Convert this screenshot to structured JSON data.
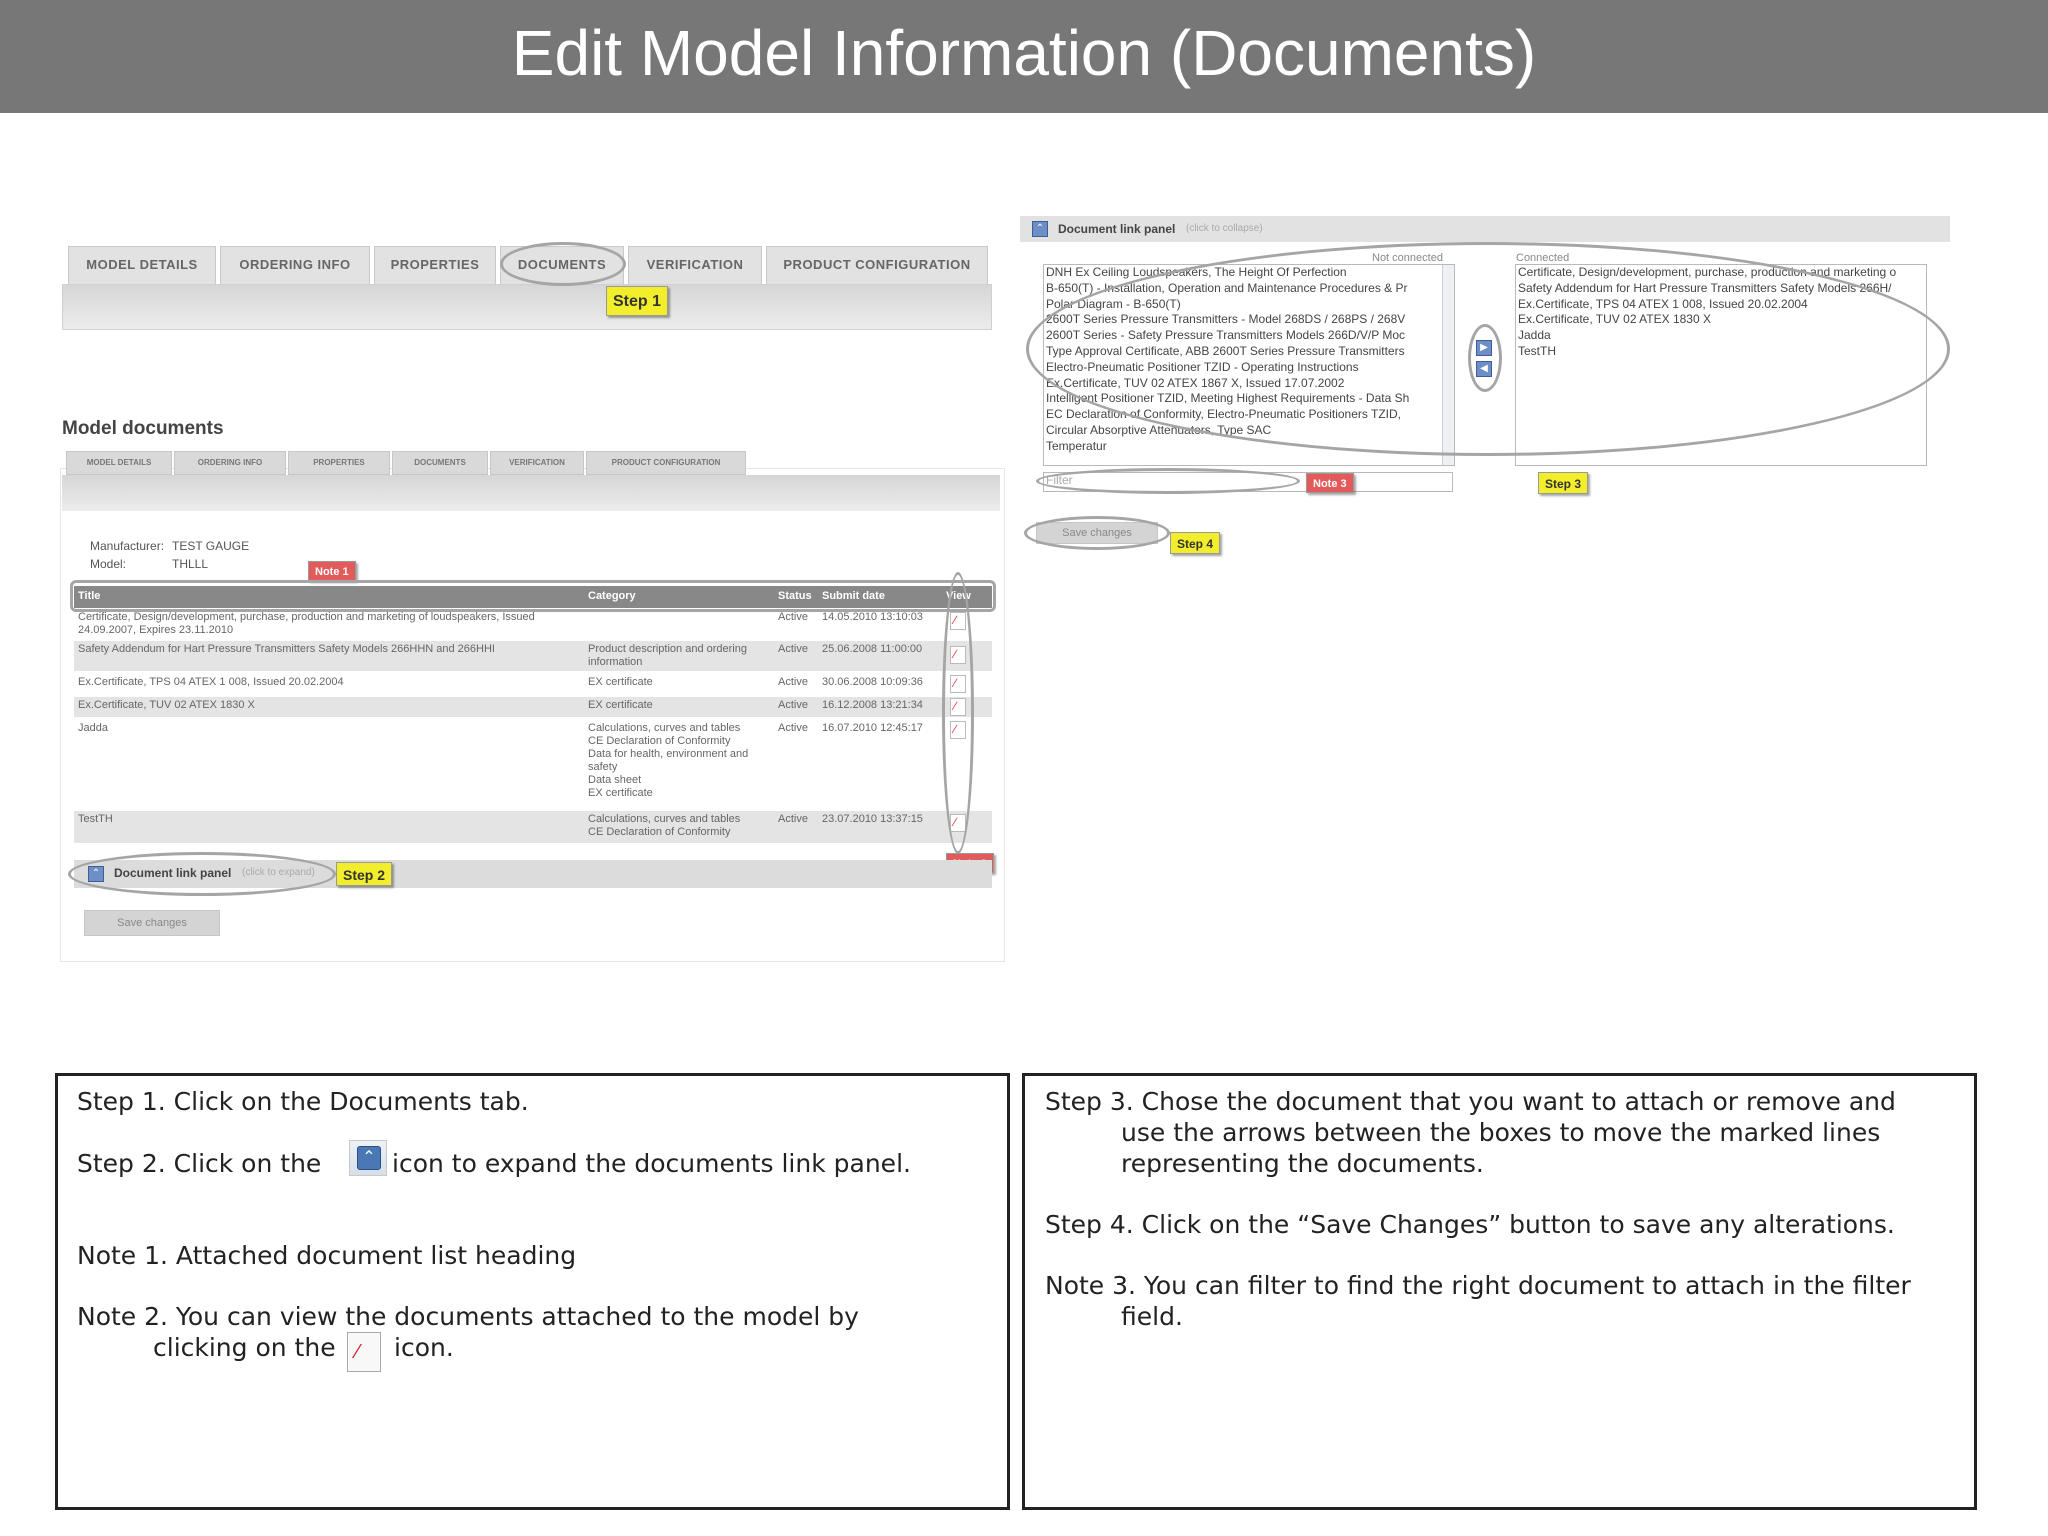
{
  "header": {
    "title": "Edit Model Information (Documents)"
  },
  "main_tabs": [
    {
      "label": "MODEL DETAILS"
    },
    {
      "label": "ORDERING INFO"
    },
    {
      "label": "PROPERTIES"
    },
    {
      "label": "DOCUMENTS"
    },
    {
      "label": "VERIFICATION"
    },
    {
      "label": "PRODUCT CONFIGURATION"
    }
  ],
  "callouts": {
    "step1": "Step 1",
    "step2": "Step 2",
    "step3": "Step 3",
    "step4": "Step 4",
    "note1": "Note 1",
    "note2": "Note 2",
    "note3": "Note 3"
  },
  "model_documents": {
    "heading": "Model documents",
    "sub_tabs": [
      "MODEL DETAILS",
      "ORDERING INFO",
      "PROPERTIES",
      "DOCUMENTS",
      "VERIFICATION",
      "PRODUCT CONFIGURATION"
    ],
    "manufacturer_label": "Manufacturer:",
    "manufacturer_value": "TEST GAUGE",
    "model_label": "Model:",
    "model_value": "THLLL",
    "columns": {
      "title": "Title",
      "category": "Category",
      "status": "Status",
      "submit_date": "Submit date",
      "view": "View"
    },
    "rows": [
      {
        "title": "Certificate, Design/development, purchase, production and marketing of loudspeakers, Issued 24.09.2007, Expires 23.11.2010",
        "category": "",
        "status": "Active",
        "date": "14.05.2010 13:10:03"
      },
      {
        "title": "Safety Addendum for Hart Pressure Transmitters Safety Models 266HHN and 266HHI",
        "category": "Product description and ordering information",
        "status": "Active",
        "date": "25.06.2008 11:00:00"
      },
      {
        "title": "Ex.Certificate, TPS 04 ATEX 1 008, Issued 20.02.2004",
        "category": "EX certificate",
        "status": "Active",
        "date": "30.06.2008 10:09:36"
      },
      {
        "title": "Ex.Certificate, TUV 02 ATEX 1830 X",
        "category": "EX certificate",
        "status": "Active",
        "date": "16.12.2008 13:21:34"
      },
      {
        "title": "Jadda",
        "category": "Calculations, curves and tables\nCE Declaration of Conformity\nData for health, environment and safety\nData sheet\nEX certificate",
        "status": "Active",
        "date": "16.07.2010 12:45:17"
      },
      {
        "title": "TestTH",
        "category": "Calculations, curves and tables\nCE Declaration of Conformity",
        "status": "Active",
        "date": "23.07.2010 13:37:15"
      }
    ],
    "link_panel_label": "Document link panel",
    "link_panel_hint": "(click to expand)",
    "save_button": "Save changes"
  },
  "link_panel": {
    "title": "Document link panel",
    "hint": "(click to collapse)",
    "not_connected_label": "Not connected",
    "connected_label": "Connected",
    "not_connected": [
      "DNH Ex Ceiling Loudspeakers, The Height Of Perfection",
      "B-650(T) - Installation, Operation and Maintenance Procedures & Pr",
      "Polar Diagram - B-650(T)",
      "2600T Series Pressure Transmitters - Model 268DS / 268PS / 268V",
      "2600T Series - Safety Pressure Transmitters Models 266D/V/P Moc",
      "Type Approval Certificate, ABB 2600T Series Pressure Transmitters",
      "Electro-Pneumatic Positioner TZID - Operating Instructions",
      "Ex.Certificate, TUV 02 ATEX 1867 X, Issued 17.07.2002",
      "Intelligent Positioner TZID, Meeting Highest Requirements - Data Sh",
      "EC Declaration of Conformity, Electro-Pneumatic Positioners TZID,",
      "Circular Absorptive Attenuators, Type SAC",
      "Temperatur"
    ],
    "connected": [
      "Certificate, Design/development, purchase, production and marketing o",
      "Safety Addendum for Hart Pressure Transmitters Safety Models 266H/",
      "Ex.Certificate, TPS 04 ATEX 1 008, Issued 20.02.2004",
      "Ex.Certificate, TUV 02 ATEX 1830 X",
      "Jadda",
      "TestTH"
    ],
    "filter_placeholder": "Filter",
    "save_button": "Save changes"
  },
  "instructions_left": {
    "step1": "Step 1. Click on the Documents tab.",
    "step2_before": "Step 2. Click on the",
    "step2_after": "icon to expand the documents link panel.",
    "note1": "Note 1. Attached document list heading",
    "note2_line1": "Note 2. You can view the documents attached to the model by",
    "note2_line2_before": "clicking on the",
    "note2_line2_after": "icon."
  },
  "instructions_right": {
    "step3_line1": "Step 3. Chose the document that you want to attach or remove and",
    "step3_line2": "use the arrows between the boxes to move the marked lines",
    "step3_line3": "representing the documents.",
    "step4": "Step 4. Click on the “Save Changes” button to save any alterations.",
    "note3_line1": "Note 3. You can filter to find the right document to attach in the filter",
    "note3_line2": "field."
  },
  "icons": {
    "expand_icon": "expand-panel-icon",
    "pdf_icon": "pdf-icon",
    "arrow_right": "move-right-icon",
    "arrow_left": "move-left-icon"
  },
  "colors": {
    "header_bg": "#777777",
    "step_callout": "#f3ee2c",
    "note_callout": "#e25b5b"
  }
}
